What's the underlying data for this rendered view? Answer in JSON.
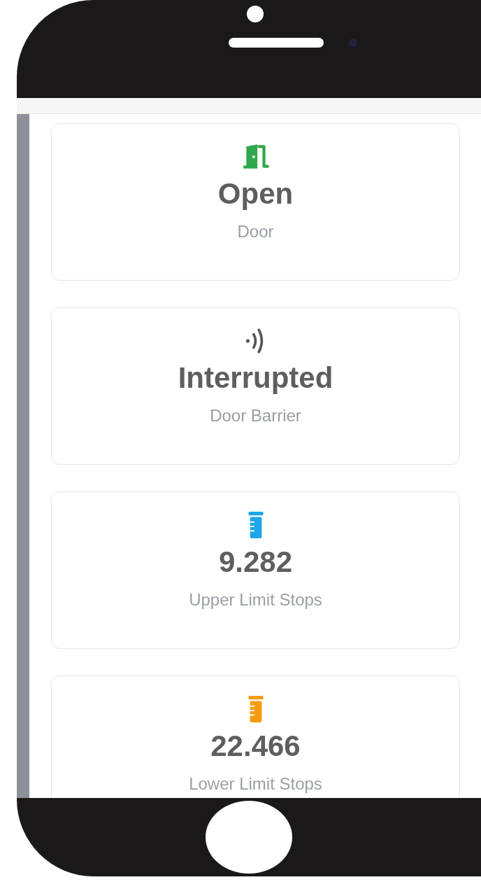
{
  "cards": [
    {
      "kind": "door",
      "color": "#2ea84a",
      "value": "Open",
      "label": "Door"
    },
    {
      "kind": "barrier",
      "color": "#555555",
      "value": "Interrupted",
      "label": "Door Barrier"
    },
    {
      "kind": "gauge",
      "color": "#1ea5e6",
      "value": "9.282",
      "label": "Upper Limit Stops"
    },
    {
      "kind": "gauge",
      "color": "#f39c12",
      "value": "22.466",
      "label": "Lower Limit Stops"
    }
  ]
}
